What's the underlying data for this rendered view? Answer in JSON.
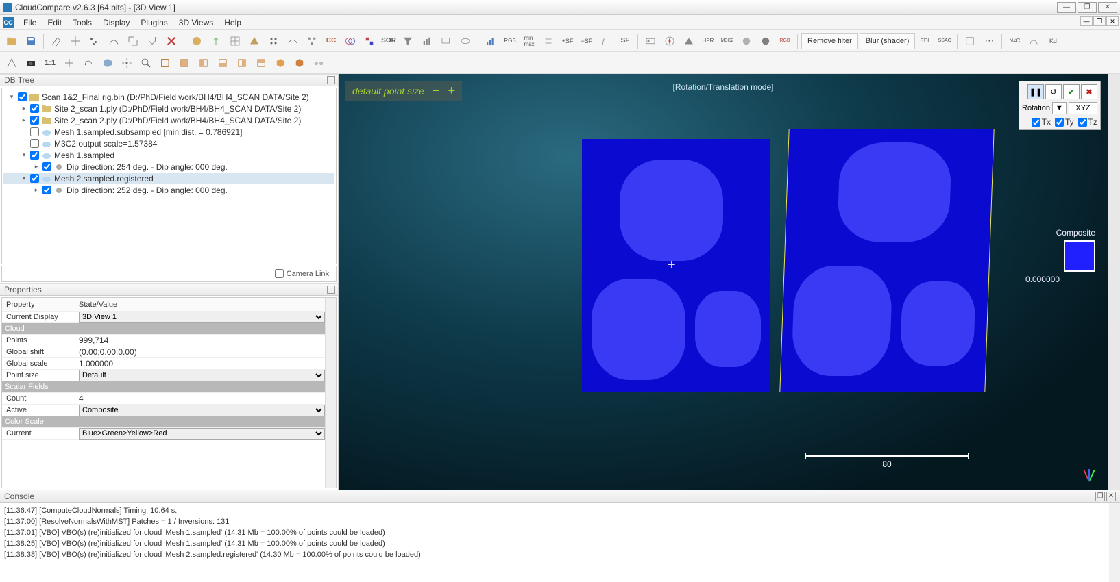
{
  "window": {
    "title": "CloudCompare v2.6.3 [64 bits] - [3D View 1]",
    "min": "—",
    "max": "❐",
    "close": "✕"
  },
  "menu": {
    "logo": "CC",
    "items": [
      "File",
      "Edit",
      "Tools",
      "Display",
      "Plugins",
      "3D Views",
      "Help"
    ]
  },
  "toolbar1": {
    "sor": "SOR",
    "sf": "SF",
    "removeFilter": "Remove filter",
    "blur": "Blur  (shader)",
    "edl": "EDL",
    "ssao": "SSAO",
    "nc": "N≠C",
    "kd": "Kd"
  },
  "toolbar2": {
    "oneToOne": "1:1",
    "front": "FRONT",
    "back": "BACK"
  },
  "dbtree": {
    "title": "DB Tree",
    "items": [
      {
        "indent": 0,
        "arrow": "▾",
        "checked": true,
        "icon": "folder",
        "label": "Scan 1&2_Final rig.bin (D:/PhD/Field work/BH4/BH4_SCAN DATA/Site 2)"
      },
      {
        "indent": 1,
        "arrow": "▸",
        "checked": true,
        "icon": "folder",
        "label": "Site 2_scan 1.ply (D:/PhD/Field work/BH4/BH4_SCAN DATA/Site 2)"
      },
      {
        "indent": 1,
        "arrow": "▸",
        "checked": true,
        "icon": "folder",
        "label": "Site 2_scan 2.ply (D:/PhD/Field work/BH4/BH4_SCAN DATA/Site 2)"
      },
      {
        "indent": 1,
        "arrow": "",
        "checked": false,
        "icon": "cloud",
        "label": "Mesh 1.sampled.subsampled [min dist. = 0.786921]"
      },
      {
        "indent": 1,
        "arrow": "",
        "checked": false,
        "icon": "cloud",
        "label": "M3C2 output scale=1.57384"
      },
      {
        "indent": 1,
        "arrow": "▾",
        "checked": true,
        "icon": "cloud",
        "label": "Mesh 1.sampled"
      },
      {
        "indent": 2,
        "arrow": "▸",
        "checked": true,
        "icon": "gray",
        "label": "Dip direction: 254 deg. - Dip angle: 000 deg."
      },
      {
        "indent": 1,
        "arrow": "▾",
        "checked": true,
        "icon": "cloud",
        "label": "Mesh 2.sampled.registered",
        "sel": true
      },
      {
        "indent": 2,
        "arrow": "▸",
        "checked": true,
        "icon": "gray",
        "label": "Dip direction: 252 deg. - Dip angle: 000 deg."
      }
    ],
    "cameraLink": "Camera Link"
  },
  "properties": {
    "title": "Properties",
    "header": {
      "k": "Property",
      "v": "State/Value"
    },
    "rows": [
      {
        "type": "kv",
        "k": "Current Display",
        "v": "3D View 1",
        "dropdown": true
      },
      {
        "type": "section",
        "label": "Cloud"
      },
      {
        "type": "kv",
        "k": "Points",
        "v": "999,714"
      },
      {
        "type": "kv",
        "k": "Global shift",
        "v": "(0.00;0.00;0.00)"
      },
      {
        "type": "kv",
        "k": "Global scale",
        "v": "1.000000"
      },
      {
        "type": "kv",
        "k": "Point size",
        "v": "Default",
        "dropdown": true
      },
      {
        "type": "section",
        "label": "Scalar Fields"
      },
      {
        "type": "kv",
        "k": "Count",
        "v": "4"
      },
      {
        "type": "kv",
        "k": "Active",
        "v": "Composite",
        "dropdown": true
      },
      {
        "type": "section",
        "label": "Color Scale"
      },
      {
        "type": "kv",
        "k": "Current",
        "v": "Blue>Green>Yellow>Red",
        "dropdown": true
      }
    ]
  },
  "view": {
    "pointSizeLabel": "default point size",
    "modeLabel": "[Rotation/Translation mode]",
    "transform": {
      "rotation": "Rotation",
      "dropdown": "▼",
      "xyz": "XYZ",
      "tx": "Tx",
      "ty": "Ty",
      "tz": "Tz"
    },
    "composite": {
      "label": "Composite",
      "value": "0.000000"
    },
    "scale": "80"
  },
  "console": {
    "title": "Console",
    "lines": [
      "[11:36:47] [ComputeCloudNormals] Timing: 10.64 s.",
      "[11:37:00] [ResolveNormalsWithMST] Patches = 1 / Inversions: 131",
      "[11:37:01] [VBO] VBO(s) (re)initialized for cloud 'Mesh 1.sampled' (14.31 Mb = 100.00% of points could be loaded)",
      "[11:38:25] [VBO] VBO(s) (re)initialized for cloud 'Mesh 1.sampled' (14.31 Mb = 100.00% of points could be loaded)",
      "[11:38:38] [VBO] VBO(s) (re)initialized for cloud 'Mesh 2.sampled.registered' (14.30 Mb = 100.00% of points could be loaded)"
    ]
  }
}
